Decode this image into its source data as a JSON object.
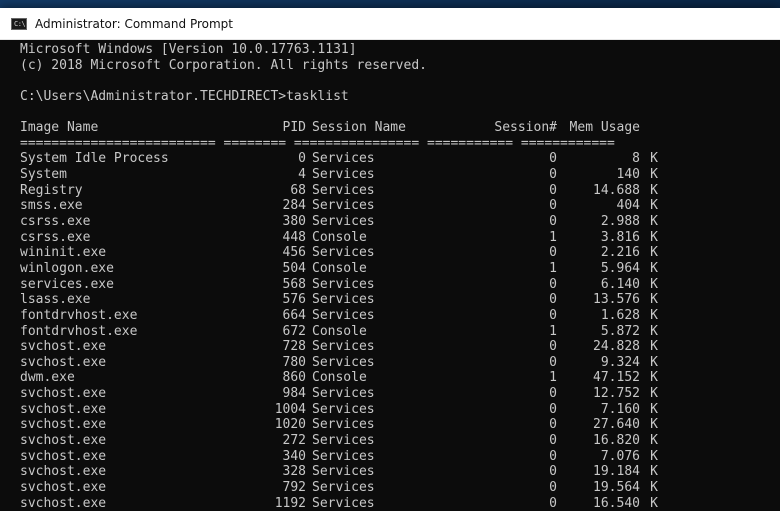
{
  "window": {
    "title": "Administrator: Command Prompt",
    "icon_name": "cmd-icon",
    "icon_text": "C:\\"
  },
  "console": {
    "banner_line1": "Microsoft Windows [Version 10.0.17763.1131]",
    "banner_line2": "(c) 2018 Microsoft Corporation. All rights reserved.",
    "prompt": "C:\\Users\\Administrator.TECHDIRECT>tasklist",
    "headers": {
      "image_name": "Image Name",
      "pid": "PID",
      "session_name": "Session Name",
      "session_num": "Session#",
      "mem_usage": "Mem Usage"
    },
    "separator": "========================= ======== ================ =========== ============",
    "rows": [
      {
        "name": "System Idle Process",
        "pid": "0",
        "session": "Services",
        "num": "0",
        "mem": "8",
        "unit": "K"
      },
      {
        "name": "System",
        "pid": "4",
        "session": "Services",
        "num": "0",
        "mem": "140",
        "unit": "K"
      },
      {
        "name": "Registry",
        "pid": "68",
        "session": "Services",
        "num": "0",
        "mem": "14.688",
        "unit": "K"
      },
      {
        "name": "smss.exe",
        "pid": "284",
        "session": "Services",
        "num": "0",
        "mem": "404",
        "unit": "K"
      },
      {
        "name": "csrss.exe",
        "pid": "380",
        "session": "Services",
        "num": "0",
        "mem": "2.988",
        "unit": "K"
      },
      {
        "name": "csrss.exe",
        "pid": "448",
        "session": "Console",
        "num": "1",
        "mem": "3.816",
        "unit": "K"
      },
      {
        "name": "wininit.exe",
        "pid": "456",
        "session": "Services",
        "num": "0",
        "mem": "2.216",
        "unit": "K"
      },
      {
        "name": "winlogon.exe",
        "pid": "504",
        "session": "Console",
        "num": "1",
        "mem": "5.964",
        "unit": "K"
      },
      {
        "name": "services.exe",
        "pid": "568",
        "session": "Services",
        "num": "0",
        "mem": "6.140",
        "unit": "K"
      },
      {
        "name": "lsass.exe",
        "pid": "576",
        "session": "Services",
        "num": "0",
        "mem": "13.576",
        "unit": "K"
      },
      {
        "name": "fontdrvhost.exe",
        "pid": "664",
        "session": "Services",
        "num": "0",
        "mem": "1.628",
        "unit": "K"
      },
      {
        "name": "fontdrvhost.exe",
        "pid": "672",
        "session": "Console",
        "num": "1",
        "mem": "5.872",
        "unit": "K"
      },
      {
        "name": "svchost.exe",
        "pid": "728",
        "session": "Services",
        "num": "0",
        "mem": "24.828",
        "unit": "K"
      },
      {
        "name": "svchost.exe",
        "pid": "780",
        "session": "Services",
        "num": "0",
        "mem": "9.324",
        "unit": "K"
      },
      {
        "name": "dwm.exe",
        "pid": "860",
        "session": "Console",
        "num": "1",
        "mem": "47.152",
        "unit": "K"
      },
      {
        "name": "svchost.exe",
        "pid": "984",
        "session": "Services",
        "num": "0",
        "mem": "12.752",
        "unit": "K"
      },
      {
        "name": "svchost.exe",
        "pid": "1004",
        "session": "Services",
        "num": "0",
        "mem": "7.160",
        "unit": "K"
      },
      {
        "name": "svchost.exe",
        "pid": "1020",
        "session": "Services",
        "num": "0",
        "mem": "27.640",
        "unit": "K"
      },
      {
        "name": "svchost.exe",
        "pid": "272",
        "session": "Services",
        "num": "0",
        "mem": "16.820",
        "unit": "K"
      },
      {
        "name": "svchost.exe",
        "pid": "340",
        "session": "Services",
        "num": "0",
        "mem": "7.076",
        "unit": "K"
      },
      {
        "name": "svchost.exe",
        "pid": "328",
        "session": "Services",
        "num": "0",
        "mem": "19.184",
        "unit": "K"
      },
      {
        "name": "svchost.exe",
        "pid": "792",
        "session": "Services",
        "num": "0",
        "mem": "19.564",
        "unit": "K"
      },
      {
        "name": "svchost.exe",
        "pid": "1192",
        "session": "Services",
        "num": "0",
        "mem": "16.540",
        "unit": "K"
      }
    ]
  }
}
